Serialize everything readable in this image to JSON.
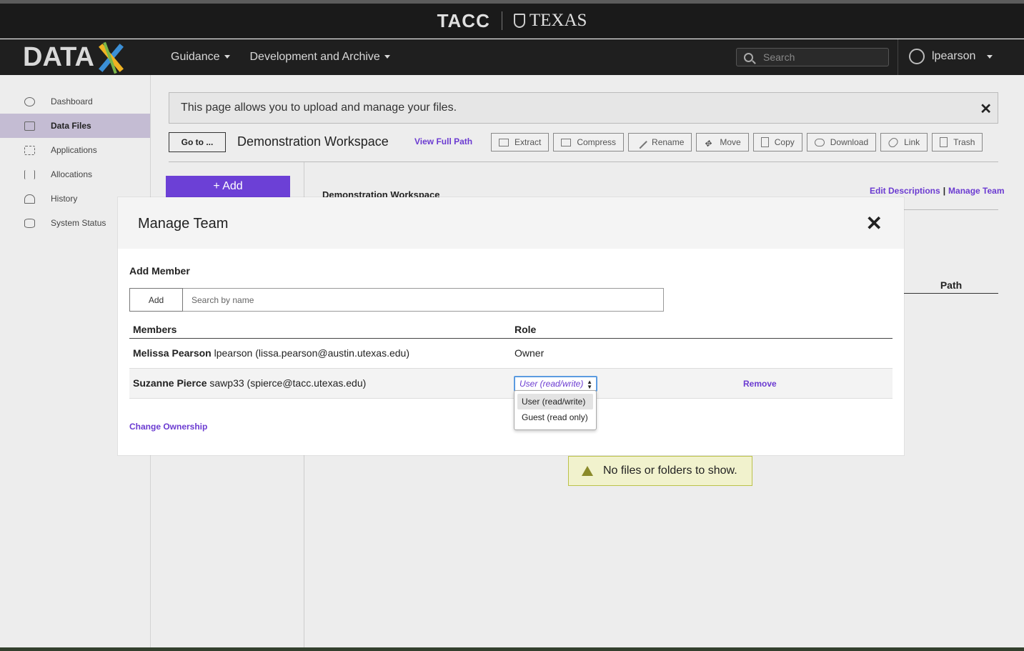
{
  "brand": {
    "tacc": "TACC",
    "texas": "TEXAS"
  },
  "nav": {
    "logo_text": "DATA",
    "menu": [
      {
        "label": "Guidance"
      },
      {
        "label": "Development and Archive"
      }
    ],
    "search_placeholder": "Search",
    "user": "lpearson"
  },
  "sidebar": {
    "items": [
      {
        "label": "Dashboard",
        "icon": "dashboard-icon"
      },
      {
        "label": "Data Files",
        "icon": "folder-icon",
        "active": true
      },
      {
        "label": "Applications",
        "icon": "grid-icon"
      },
      {
        "label": "Allocations",
        "icon": "sliders-icon"
      },
      {
        "label": "History",
        "icon": "bell-icon"
      },
      {
        "label": "System Status",
        "icon": "database-icon"
      }
    ]
  },
  "main": {
    "message": "This page allows you to upload and manage your files.",
    "goto_label": "Go to ...",
    "workspace_title": "Demonstration Workspace",
    "view_full_path": "View Full Path",
    "toolbar_buttons": [
      "Extract",
      "Compress",
      "Rename",
      "Move",
      "Copy",
      "Download",
      "Link",
      "Trash"
    ],
    "add_label": "+ Add",
    "workspace_sub": "Demonstration Workspace",
    "edit_descriptions": "Edit Descriptions",
    "manage_team_link": "Manage Team",
    "path_header": "Path",
    "no_files": "No files or folders to show."
  },
  "modal": {
    "title": "Manage Team",
    "add_member_heading": "Add Member",
    "add_button": "Add",
    "search_placeholder": "Search by name",
    "members_header": "Members",
    "role_header": "Role",
    "members": [
      {
        "name": "Melissa Pearson",
        "detail": "lpearson (lissa.pearson@austin.utexas.edu)",
        "role": "Owner"
      },
      {
        "name": "Suzanne Pierce",
        "detail": "sawp33 (spierce@tacc.utexas.edu)",
        "role": "User (read/write)",
        "remove": "Remove"
      }
    ],
    "role_options": [
      "User (read/write)",
      "Guest (read only)"
    ],
    "selected_role": "User (read/write)",
    "change_ownership": "Change Ownership"
  },
  "colors": {
    "accent": "#6b3bd1",
    "add_button": "#6c40d6"
  }
}
